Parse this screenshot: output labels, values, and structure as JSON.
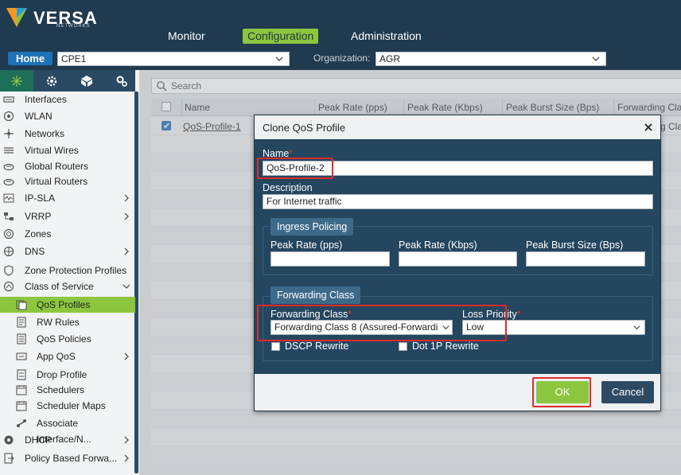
{
  "brand": {
    "name": "VERSA",
    "sub": "NETWORKS"
  },
  "nav": {
    "monitor": "Monitor",
    "configuration": "Configuration",
    "administration": "Administration"
  },
  "bar2": {
    "home": "Home",
    "device": "CPE1",
    "org_label": "Organization:",
    "org_value": "AGR"
  },
  "sidebar": {
    "items": [
      {
        "label": "Interfaces"
      },
      {
        "label": "WLAN"
      },
      {
        "label": "Networks"
      },
      {
        "label": "Virtual Wires"
      },
      {
        "label": "Global Routers"
      },
      {
        "label": "Virtual Routers"
      },
      {
        "label": "IP-SLA"
      },
      {
        "label": "VRRP"
      },
      {
        "label": "Zones"
      },
      {
        "label": "DNS"
      },
      {
        "label": "Zone Protection Profiles"
      },
      {
        "label": "Class of Service"
      },
      {
        "label": "QoS Profiles"
      },
      {
        "label": "RW Rules"
      },
      {
        "label": "QoS Policies"
      },
      {
        "label": "App QoS"
      },
      {
        "label": "Drop Profile"
      },
      {
        "label": "Schedulers"
      },
      {
        "label": "Scheduler Maps"
      },
      {
        "label": "Associate Interface/N..."
      },
      {
        "label": "DHCP"
      },
      {
        "label": "Policy Based Forwa..."
      }
    ]
  },
  "main": {
    "search_placeholder": "Search",
    "columns": [
      "Name",
      "Peak Rate (pps)",
      "Peak Rate (Kbps)",
      "Peak Burst Size (Bps)",
      "Forwarding Cla"
    ],
    "row1_name": "QoS-Profile-1",
    "row1_tail": "g Cla"
  },
  "modal": {
    "title": "Clone QoS Profile",
    "name_label": "Name",
    "name_value": "QoS-Profile-2",
    "desc_label": "Description",
    "desc_value": "For Internet traffic",
    "ingress_legend": "Ingress Policing",
    "peak_pps": "Peak Rate (pps)",
    "peak_kbps": "Peak Rate (Kbps)",
    "peak_burst": "Peak Burst Size (Bps)",
    "fc_legend": "Forwarding Class",
    "fc_label": "Forwarding Class",
    "fc_value": "Forwarding Class 8 (Assured-Forwardi",
    "loss_label": "Loss Priority",
    "loss_value": "Low",
    "dscp": "DSCP Rewrite",
    "dot1p": "Dot 1P Rewrite",
    "ok": "OK",
    "cancel": "Cancel"
  },
  "colors": {
    "accent": "#8cc63f",
    "nav_bg": "#203a4f",
    "modal_bg": "#24465f",
    "highlight": "#e02a2a"
  }
}
